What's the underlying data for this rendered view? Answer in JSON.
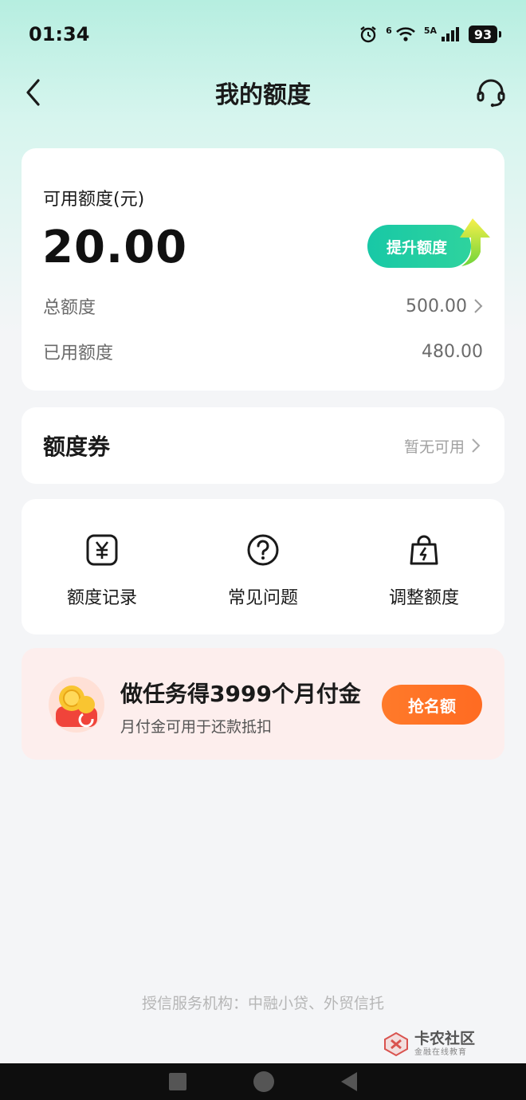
{
  "status_bar": {
    "time": "01:34",
    "network_label": "5A",
    "wifi_label": "6",
    "battery": "93",
    "icons": [
      "alarm-icon",
      "wifi-icon",
      "signal-icon",
      "battery-icon"
    ]
  },
  "header": {
    "title": "我的额度",
    "back_icon": "chevron-left-icon",
    "service_icon": "headset-icon"
  },
  "quota": {
    "label": "可用额度(元)",
    "available": "20.00",
    "raise_button": "提升额度",
    "total_label": "总额度",
    "total_value": "500.00",
    "used_label": "已用额度",
    "used_value": "480.00"
  },
  "coupon": {
    "title": "额度券",
    "status": "暂无可用"
  },
  "shortcuts": [
    {
      "label": "额度记录",
      "icon": "yen-receipt-icon"
    },
    {
      "label": "常见问题",
      "icon": "question-circle-icon"
    },
    {
      "label": "调整额度",
      "icon": "bag-bolt-icon"
    }
  ],
  "promo": {
    "title": "做任务得3999个月付金",
    "subtitle": "月付金可用于还款抵扣",
    "button": "抢名额",
    "icon": "coin-wallet-icon"
  },
  "footer": {
    "note": "授信服务机构：中融小贷、外贸信托"
  },
  "watermark": {
    "main": "卡农社区",
    "sub": "金融在线教育"
  },
  "colors": {
    "accent_green": "#18c8a6",
    "promo_orange": "#ff7a2a",
    "header_bg": "#b6eee0"
  }
}
